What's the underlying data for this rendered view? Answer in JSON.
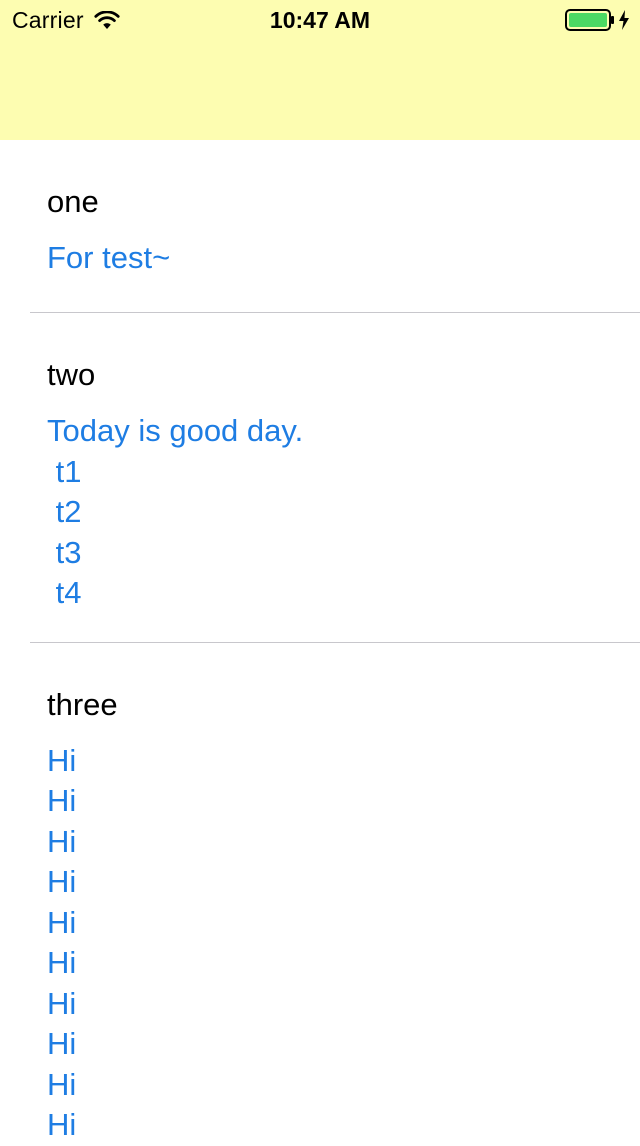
{
  "status_bar": {
    "carrier": "Carrier",
    "time": "10:47 AM"
  },
  "colors": {
    "header_background": "#fdfdb1",
    "link_text": "#1e7de3",
    "battery_fill": "#4cd964",
    "separator": "#c8c7cc"
  },
  "icons": {
    "wifi": "wifi-icon",
    "battery": "battery-icon",
    "charging": "charging-bolt-icon"
  },
  "cells": [
    {
      "title": "one",
      "body": "For test~"
    },
    {
      "title": "two",
      "body": "Today is good day.\n t1\n t2\n t3\n t4"
    },
    {
      "title": "three",
      "body": "Hi\nHi\nHi\nHi\nHi\nHi\nHi\nHi\nHi\nHi"
    }
  ]
}
